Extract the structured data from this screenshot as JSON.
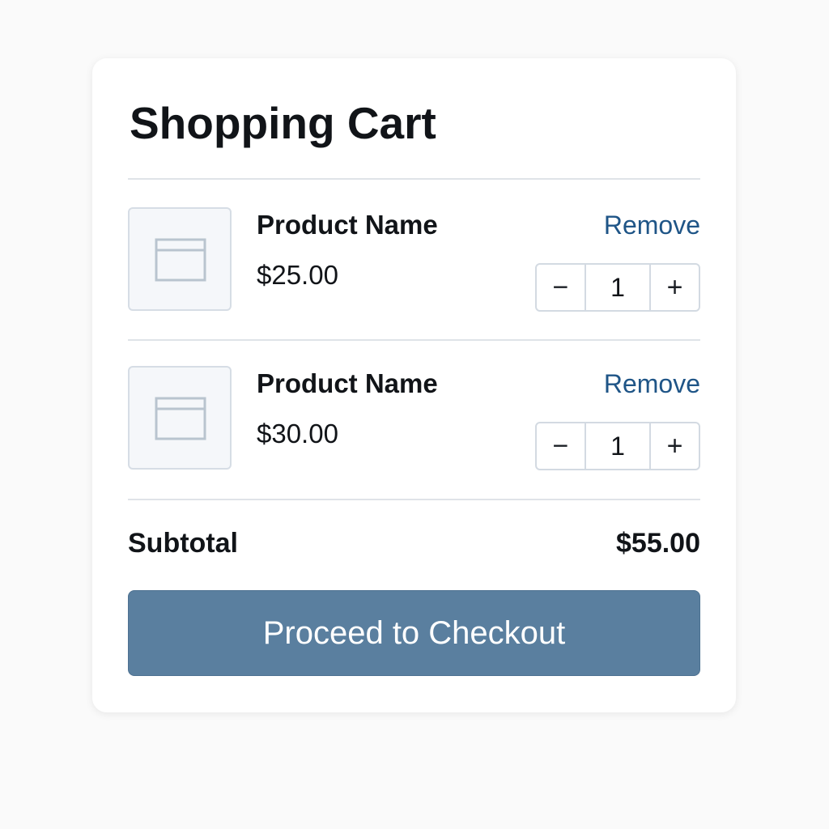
{
  "cart": {
    "title": "Shopping Cart",
    "items": [
      {
        "name": "Product Name",
        "price": "$25.00",
        "remove_label": "Remove",
        "quantity": "1",
        "decrement_label": "−",
        "increment_label": "+",
        "image_icon": "image-placeholder-icon"
      },
      {
        "name": "Product Name",
        "price": "$30.00",
        "remove_label": "Remove",
        "quantity": "1",
        "decrement_label": "−",
        "increment_label": "+",
        "image_icon": "image-placeholder-icon"
      }
    ],
    "subtotal_label": "Subtotal",
    "subtotal_value": "$55.00",
    "checkout_label": "Proceed to Checkout"
  },
  "colors": {
    "accent": "#5a7f9f",
    "link": "#1f5587",
    "divider": "#dfe3e8",
    "background": "#fafafa",
    "card": "#ffffff"
  }
}
